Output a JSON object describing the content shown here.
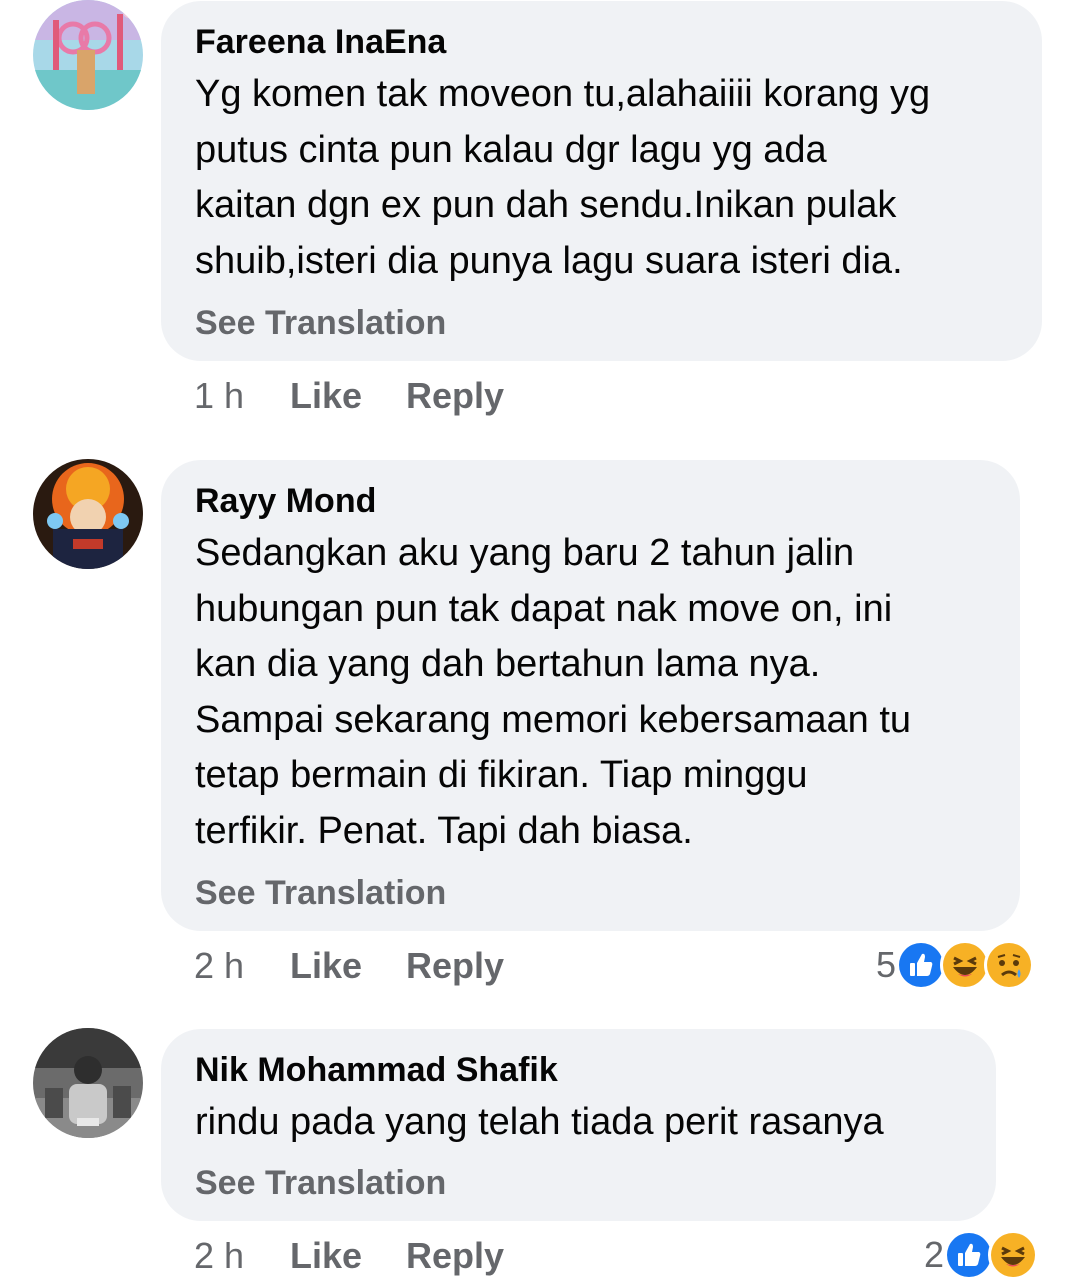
{
  "comments": [
    {
      "author": "Fareena InaEna",
      "lines": [
        "Yg komen tak moveon tu,alahaiiii korang yg",
        "putus cinta pun kalau dgr lagu yg ada",
        "kaitan dgn ex pun dah sendu.Inikan pulak",
        "shuib,isteri dia punya lagu suara isteri dia."
      ],
      "see_translation": "See Translation",
      "time": "1 h",
      "like": "Like",
      "reply": "Reply"
    },
    {
      "author": "Rayy Mond",
      "lines": [
        "Sedangkan aku yang baru 2 tahun jalin",
        "hubungan pun tak dapat nak move on, ini",
        "kan dia yang dah bertahun lama nya.",
        "Sampai sekarang memori kebersamaan tu",
        "tetap bermain di fikiran. Tiap minggu",
        "terfikir. Penat. Tapi dah biasa."
      ],
      "see_translation": "See Translation",
      "time": "2 h",
      "like": "Like",
      "reply": "Reply",
      "reaction_count": "5",
      "reactions": [
        "like-reaction-icon",
        "haha-reaction-icon",
        "sad-reaction-icon"
      ]
    },
    {
      "author": "Nik Mohammad Shafik",
      "lines": [
        "rindu pada yang telah tiada perit rasanya"
      ],
      "see_translation": "See Translation",
      "time": "2 h",
      "like": "Like",
      "reply": "Reply",
      "reaction_count": "2",
      "reactions": [
        "like-reaction-icon",
        "haha-reaction-icon"
      ]
    }
  ],
  "colors": {
    "bubble": "#f0f2f5",
    "secondary_text": "#65676b",
    "like_blue": "#1877f2",
    "haha_yellow": "#f7b125"
  }
}
